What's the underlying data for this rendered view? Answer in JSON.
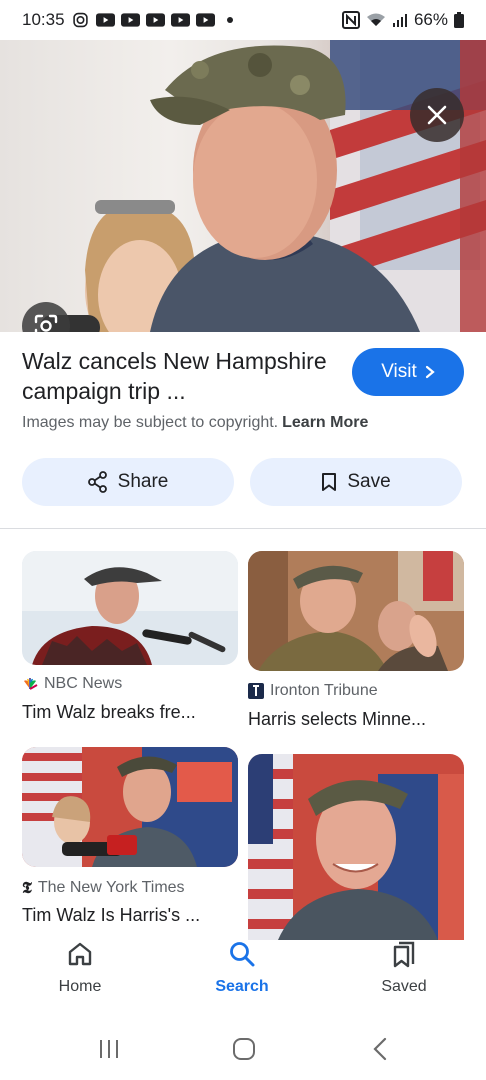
{
  "status_bar": {
    "time": "10:35",
    "battery": "66%",
    "app_icons": [
      "instagram-icon",
      "youtube-icon",
      "youtube-icon",
      "youtube-icon",
      "youtube-icon",
      "youtube-icon"
    ],
    "system_icons": [
      "nfc-icon",
      "wifi-icon",
      "signal-icon",
      "battery-icon"
    ]
  },
  "preview": {
    "title": "Walz cancels New Hampshire campaign trip ...",
    "visit_label": "Visit",
    "copyright_text": "Images may be subject to copyright.",
    "learn_more": "Learn More",
    "share_label": "Share",
    "save_label": "Save"
  },
  "results": [
    {
      "source": "NBC News",
      "title": "Tim Walz breaks fre...",
      "source_icon": "nbc-peacock-icon"
    },
    {
      "source": "Ironton Tribune",
      "title": "Harris selects Minne...",
      "source_icon": "ironton-tribune-icon"
    },
    {
      "source": "The New York Times",
      "title": "Tim Walz Is Harris's ...",
      "source_icon": "nyt-icon"
    },
    {
      "source": "",
      "title": "",
      "source_icon": ""
    }
  ],
  "bottom_nav": {
    "items": [
      {
        "label": "Home",
        "icon": "home-icon"
      },
      {
        "label": "Search",
        "icon": "search-icon",
        "active": true
      },
      {
        "label": "Saved",
        "icon": "saved-icon"
      }
    ]
  },
  "colors": {
    "accent": "#1a73e8",
    "button_bg": "#e8f0fe"
  }
}
